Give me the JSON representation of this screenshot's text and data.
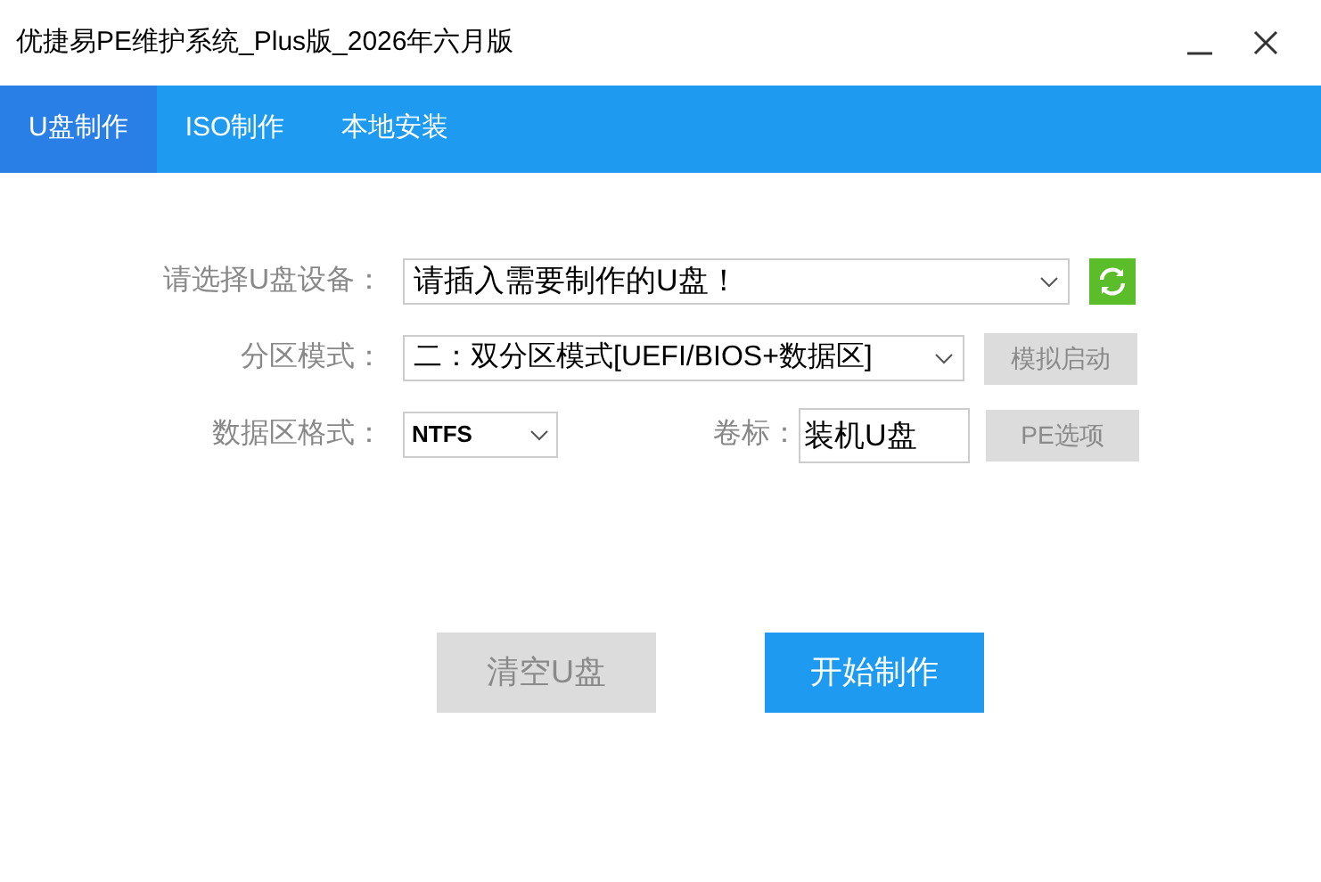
{
  "window": {
    "title": "优捷易PE维护系统_Plus版_2026年六月版"
  },
  "tabs": [
    {
      "label": "U盘制作",
      "selected": true
    },
    {
      "label": "ISO制作",
      "selected": false
    },
    {
      "label": "本地安装",
      "selected": false
    }
  ],
  "form": {
    "device_label": "请选择U盘设备：",
    "device_value": "请插入需要制作的U盘！",
    "partition_label": "分区模式：",
    "partition_value": "二：双分区模式[UEFI/BIOS+数据区]",
    "simulate_button": {
      "label": "模拟启动",
      "disabled": true
    },
    "format_label": "数据区格式：",
    "format_value": "NTFS",
    "volume_label": "卷标：",
    "volume_value": "装机U盘",
    "pe_options_button": {
      "label": "PE选项",
      "disabled": true
    }
  },
  "actions": [
    {
      "label": "清空U盘",
      "disabled": true
    },
    {
      "label": "开始制作",
      "disabled": false
    }
  ]
}
